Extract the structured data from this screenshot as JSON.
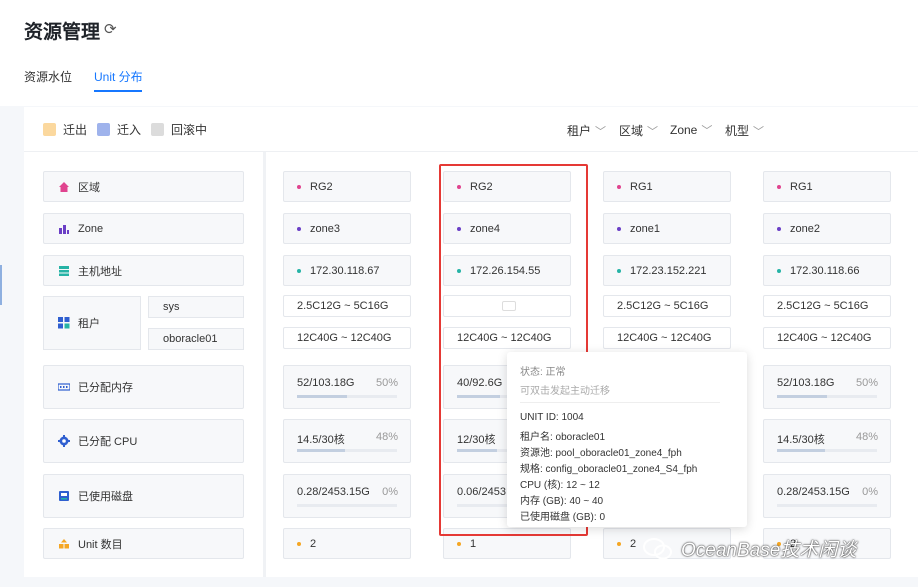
{
  "header": {
    "title": "资源管理",
    "tabs": [
      {
        "label": "资源水位"
      },
      {
        "label": "Unit 分布"
      }
    ]
  },
  "legend": [
    {
      "label": "迁出",
      "color": "#fbd89e"
    },
    {
      "label": "迁入",
      "color": "#9fb3ec"
    },
    {
      "label": "回滚中",
      "color": "#dcdcdc"
    }
  ],
  "filters": [
    {
      "label": "租户"
    },
    {
      "label": "区域"
    },
    {
      "label": "Zone"
    },
    {
      "label": "机型"
    }
  ],
  "rows": {
    "region": "区域",
    "zone": "Zone",
    "host": "主机地址",
    "tenant": "租户",
    "tenant_subs": [
      "sys",
      "oboracle01"
    ],
    "mem": "已分配内存",
    "cpu": "已分配 CPU",
    "disk": "已使用磁盘",
    "unit": "Unit 数目"
  },
  "columns": [
    {
      "region": "RG2",
      "zone": "zone3",
      "host": "172.30.118.67",
      "sys": "2.5C12G ~ 5C16G",
      "oboracle": "12C40G ~ 12C40G",
      "mem": "52/103.18G",
      "mem_pct": "50%",
      "mem_fill": 0.5,
      "cpu": "14.5/30核",
      "cpu_pct": "48%",
      "cpu_fill": 0.48,
      "disk": "0.28/2453.15G",
      "disk_pct": "0%",
      "disk_fill": 0.0,
      "units": "2"
    },
    {
      "region": "RG2",
      "zone": "zone4",
      "host": "172.26.154.55",
      "sys": "",
      "oboracle": "12C40G ~ 12C40G",
      "mem": "40/92.6G",
      "mem_pct": "",
      "mem_fill": 0.43,
      "cpu": "12/30核",
      "cpu_pct": "",
      "cpu_fill": 0.4,
      "disk": "0.06/2453",
      "disk_pct": "",
      "disk_fill": 0.0,
      "units": "1"
    },
    {
      "region": "RG1",
      "zone": "zone1",
      "host": "172.23.152.221",
      "sys": "2.5C12G ~ 5C16G",
      "oboracle": "12C40G ~ 12C40G",
      "mem": "",
      "mem_pct": "",
      "mem_fill": 0.5,
      "cpu": "",
      "cpu_pct": "",
      "cpu_fill": 0.48,
      "disk": "",
      "disk_pct": "",
      "disk_fill": 0.0,
      "units": "2"
    },
    {
      "region": "RG1",
      "zone": "zone2",
      "host": "172.30.118.66",
      "sys": "2.5C12G ~ 5C16G",
      "oboracle": "12C40G ~ 12C40G",
      "mem": "52/103.18G",
      "mem_pct": "50%",
      "mem_fill": 0.5,
      "cpu": "14.5/30核",
      "cpu_pct": "48%",
      "cpu_fill": 0.48,
      "disk": "0.28/2453.15G",
      "disk_pct": "0%",
      "disk_fill": 0.0,
      "units": "2"
    }
  ],
  "tooltip": {
    "status": "状态: 正常",
    "hint": "可双击发起主动迁移",
    "lines": [
      "UNIT ID: 1004",
      "租户名: oboracle01",
      "资源池: pool_oboracle01_zone4_fph",
      "规格: config_oboracle01_zone4_S4_fph",
      "CPU (核): 12 ~ 12",
      "内存 (GB): 40 ~ 40",
      "已使用磁盘 (GB): 0"
    ]
  },
  "watermark": "OceanBase技术闲谈",
  "colors": {
    "region_dot": "#e0448f",
    "zone_dot": "#6b3fc6",
    "host_dot": "#26b3a6",
    "unit_dot": "#f5a623",
    "accent": "#1677ff",
    "highlight": "#e53935"
  },
  "icons": {
    "region": "home-icon",
    "zone": "bar-chart-icon",
    "host": "server-icon",
    "tenant": "grid-icon",
    "mem": "memory-icon",
    "cpu": "gear-icon",
    "disk": "disk-icon",
    "unit": "stack-icon"
  }
}
